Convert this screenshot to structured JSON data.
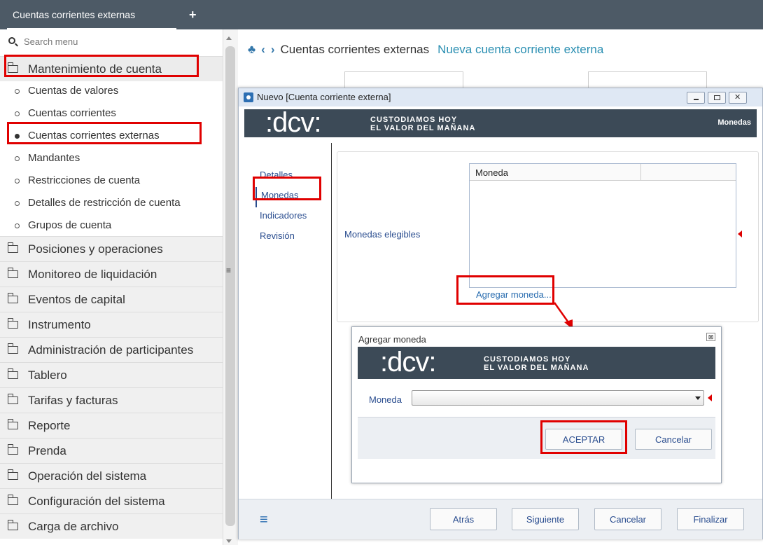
{
  "app": {
    "tab_label": "Cuentas corrientes externas",
    "add_tab_glyph": "+"
  },
  "sidebar": {
    "search_placeholder": "Search menu",
    "sections": [
      {
        "label": "Mantenimiento de cuenta",
        "state": "expanded"
      },
      {
        "label": "Posiciones y operaciones"
      },
      {
        "label": "Monitoreo de liquidación"
      },
      {
        "label": "Eventos de capital"
      },
      {
        "label": "Instrumento"
      },
      {
        "label": "Administración de participantes"
      },
      {
        "label": "Tablero"
      },
      {
        "label": "Tarifas y facturas"
      },
      {
        "label": "Reporte"
      },
      {
        "label": "Prenda"
      },
      {
        "label": "Operación del sistema"
      },
      {
        "label": "Configuración del sistema"
      },
      {
        "label": "Carga de archivo"
      }
    ],
    "subitems": [
      {
        "label": "Cuentas de valores"
      },
      {
        "label": "Cuentas corrientes"
      },
      {
        "label": "Cuentas corrientes externas",
        "selected": true
      },
      {
        "label": "Mandantes"
      },
      {
        "label": "Restricciones de cuenta"
      },
      {
        "label": "Detalles de restricción de cuenta"
      },
      {
        "label": "Grupos de cuenta"
      }
    ]
  },
  "breadcrumb": {
    "parent": "Cuentas corrientes externas",
    "current": "Nueva cuenta corriente externa"
  },
  "window": {
    "title": "Nuevo [Cuenta corriente externa]",
    "banner_logo": ":dcv:",
    "banner_tagline_1": "CUSTODIAMOS HOY",
    "banner_tagline_2": "EL VALOR DEL MAÑANA",
    "banner_right": "Monedas",
    "nav": [
      "Detalles",
      "Monedas",
      "Indicadores",
      "Revisión"
    ],
    "active_nav": "Monedas",
    "field_label": "Monedas elegibles",
    "grid_header": "Moneda",
    "add_link": "Agregar moneda...",
    "footer_buttons": [
      "Atrás",
      "Siguiente",
      "Cancelar",
      "Finalizar"
    ]
  },
  "dialog": {
    "title": "Agregar moneda",
    "close_glyph": "⊠",
    "banner_logo": ":dcv:",
    "banner_tagline_1": "CUSTODIAMOS HOY",
    "banner_tagline_2": "EL VALOR DEL MAÑANA",
    "field_label": "Moneda",
    "select_value": "",
    "ok_label": "ACEPTAR",
    "cancel_label": "Cancelar"
  },
  "colors": {
    "highlight": "#e00000",
    "topbar": "#4d5a66",
    "banner": "#3c4a57",
    "link": "#2a6db0"
  }
}
